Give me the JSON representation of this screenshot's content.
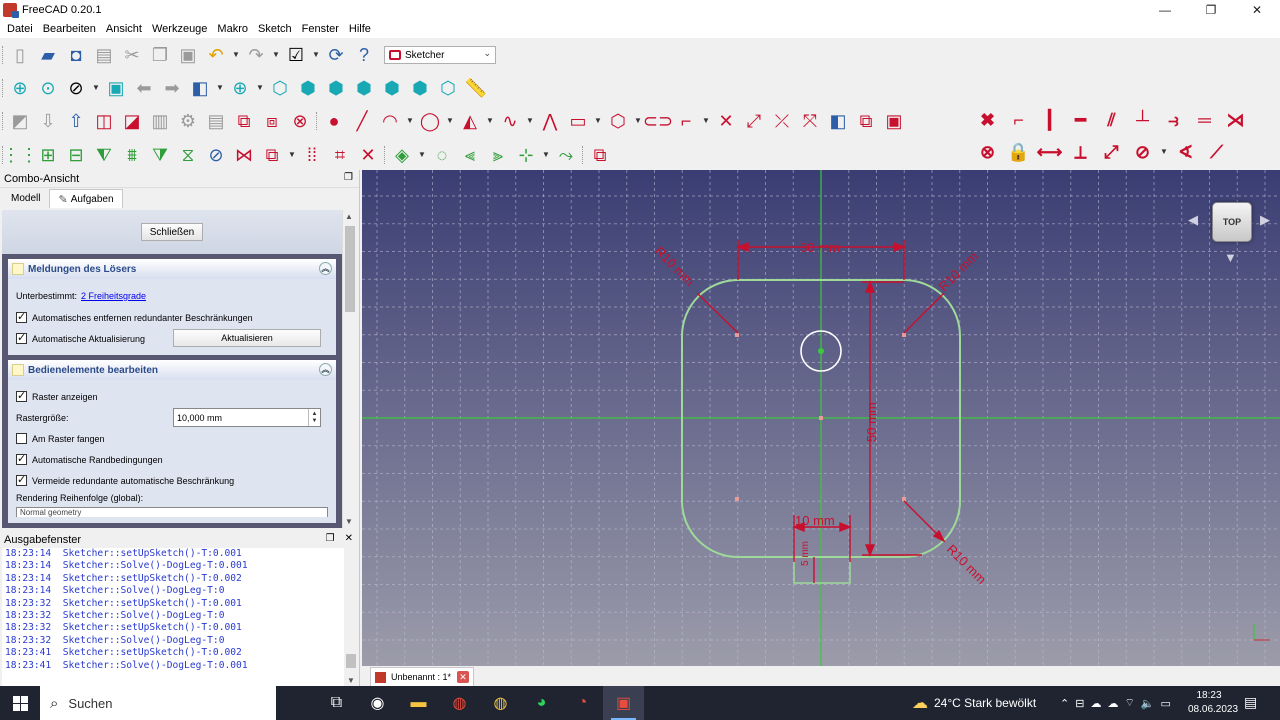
{
  "window": {
    "title": "FreeCAD 0.20.1",
    "minimize": "—",
    "maximize": "❐",
    "close": "✕"
  },
  "menu": [
    "Datei",
    "Bearbeiten",
    "Ansicht",
    "Werkzeuge",
    "Makro",
    "Sketch",
    "Fenster",
    "Hilfe"
  ],
  "workbench": {
    "selected": "Sketcher"
  },
  "combo": {
    "title": "Combo-Ansicht",
    "tabs": {
      "model": "Modell",
      "tasks": "Aufgaben"
    },
    "close_button": "Schließen",
    "solver": {
      "header": "Meldungen des Lösers",
      "under_label": "Unterbestimmt:",
      "dof_link": "2 Freiheitsgrade",
      "auto_remove": "Automatisches entfernen redundanter Beschränkungen",
      "auto_update": "Automatische Aktualisierung",
      "update_button": "Aktualisieren"
    },
    "controls": {
      "header": "Bedienelemente bearbeiten",
      "show_grid": "Raster anzeigen",
      "grid_size_label": "Rastergröße:",
      "grid_size_value": "10,000 mm",
      "snap_grid": "Am Raster fangen",
      "auto_constraints": "Automatische Randbedingungen",
      "avoid_redundant": "Vermeide redundante automatische Beschränkung",
      "render_order": "Rendering Reihenfolge (global):",
      "render_value": "Normal geometry"
    }
  },
  "output": {
    "title": "Ausgabefenster",
    "lines": [
      "18:23:14  Sketcher::setUpSketch()-T:0.001",
      "18:23:14  Sketcher::Solve()-DogLeg-T:0.001",
      "18:23:14  Sketcher::setUpSketch()-T:0.002",
      "18:23:14  Sketcher::Solve()-DogLeg-T:0",
      "18:23:32  Sketcher::setUpSketch()-T:0.001",
      "18:23:32  Sketcher::Solve()-DogLeg-T:0",
      "18:23:32  Sketcher::setUpSketch()-T:0.001",
      "18:23:32  Sketcher::Solve()-DogLeg-T:0",
      "18:23:41  Sketcher::setUpSketch()-T:0.002",
      "18:23:41  Sketcher::Solve()-DogLeg-T:0.001"
    ]
  },
  "view": {
    "navcube_face": "TOP",
    "dim_top": "30 mm",
    "dim_height": "50 mm",
    "dim_bottom": "10 mm",
    "dim_small": "5 mm",
    "radius_tl": "R10 mm",
    "radius_tr": "R10 mm",
    "radius_br": "R10 mm"
  },
  "doc_tab": {
    "label": "Unbenannt : 1*"
  },
  "taskbar": {
    "search": "Suchen",
    "weather": "24°C  Stark bewölkt",
    "time": "18:23",
    "date": "08.06.2023"
  },
  "colors": {
    "sketch_line": "#9fd99a",
    "dimension": "#c8102e",
    "axis": "#3cc83c",
    "bg_top": "#3a3d73",
    "bg_bottom": "#9c9caa"
  }
}
